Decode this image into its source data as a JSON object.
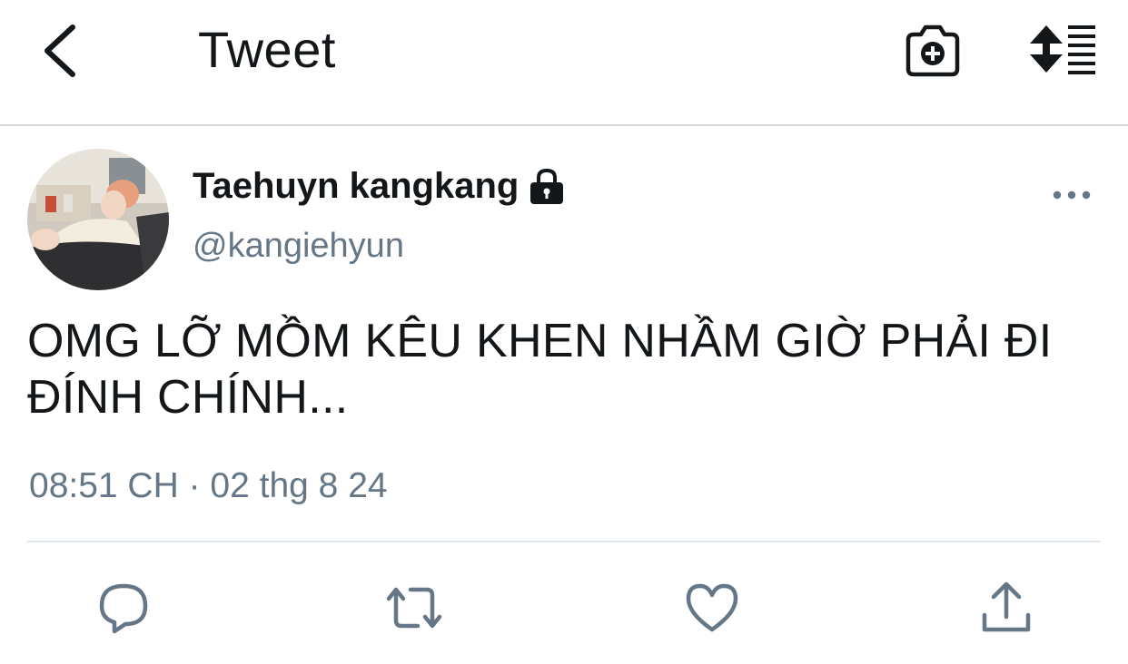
{
  "header": {
    "title": "Tweet",
    "back_icon": "chevron-left-icon",
    "camera_icon": "camera-add-icon",
    "sort_icon": "sort-list-icon"
  },
  "tweet": {
    "display_name": "Taehuyn kangkang",
    "handle": "@kangiehyun",
    "protected_icon": "lock-icon",
    "text_line1": "OMG LỠ MỒM KÊU KHEN NHẦM GIỜ PHẢI ĐI",
    "text_line2": "ĐÍNH CHÍNH...",
    "timestamp": "08:51 CH · 02 thg 8 24"
  },
  "actions": [
    {
      "icon": "reply-icon"
    },
    {
      "icon": "retweet-icon"
    },
    {
      "icon": "like-icon"
    },
    {
      "icon": "share-icon"
    }
  ],
  "colors": {
    "text_primary": "#14171a",
    "text_secondary": "#657786",
    "icon_gray": "#657786",
    "divider": "#e1e8ed"
  }
}
